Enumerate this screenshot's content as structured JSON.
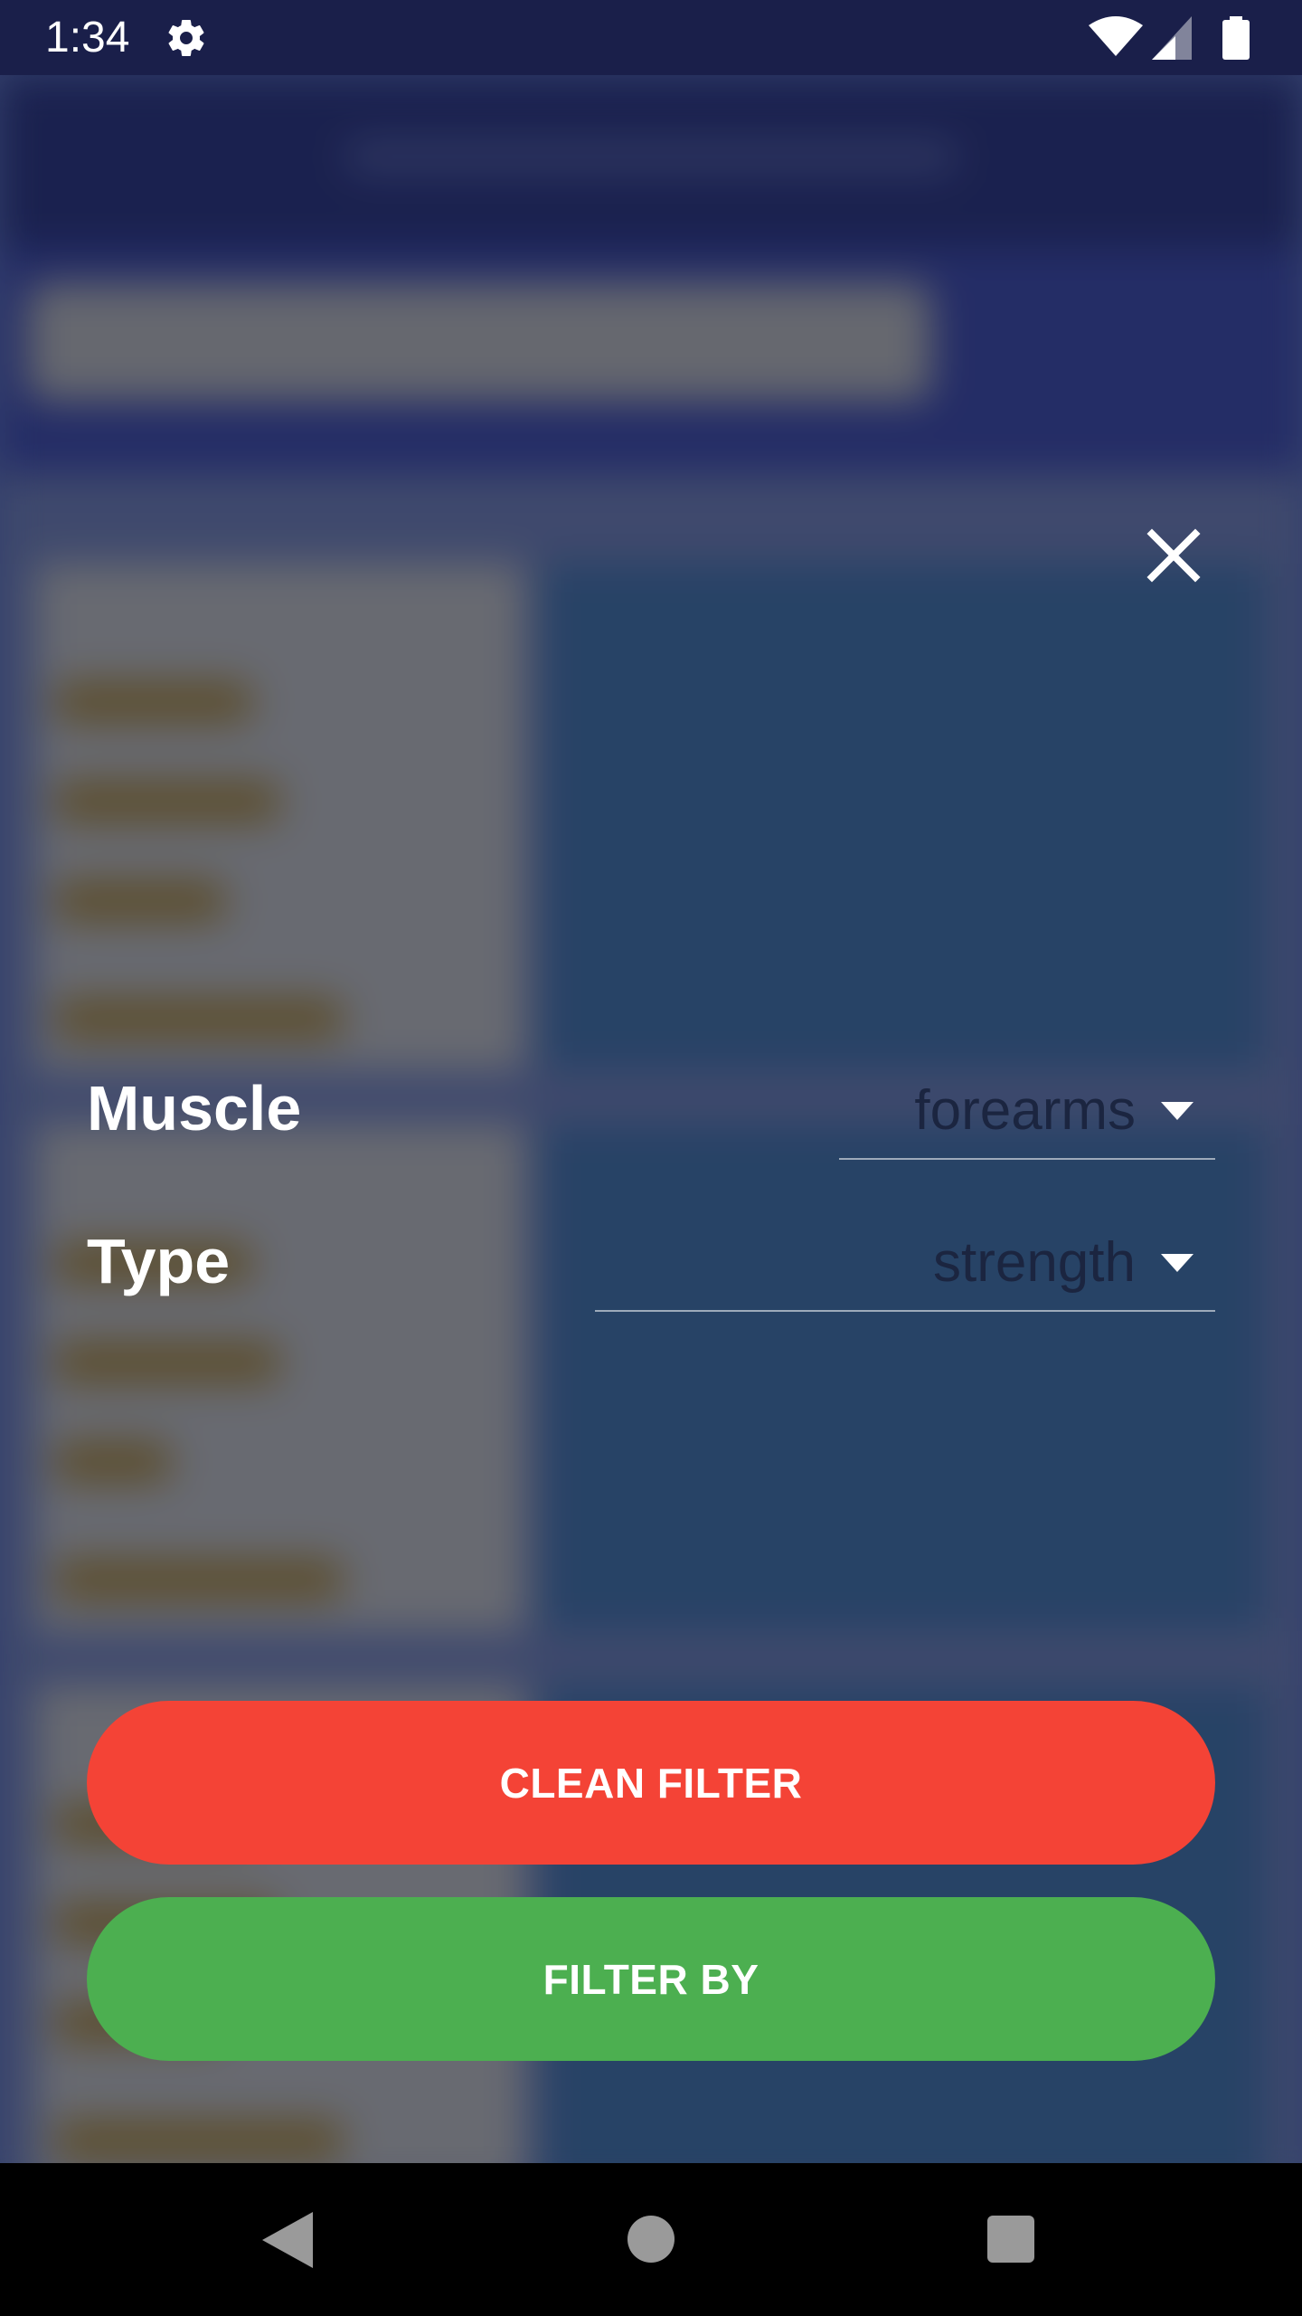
{
  "status_bar": {
    "time": "1:34",
    "icons": [
      "gear-icon",
      "wifi-icon",
      "cellular-signal-icon",
      "battery-icon"
    ]
  },
  "filter_dialog": {
    "close_icon": "close-icon",
    "muscle": {
      "label": "Muscle",
      "selected": "forearms"
    },
    "type": {
      "label": "Type",
      "selected": "strength"
    },
    "clean_button_label": "CLEAN FILTER",
    "filter_button_label": "FILTER BY"
  },
  "nav_bar": {
    "icons": [
      "back-icon",
      "home-icon",
      "recents-icon"
    ]
  },
  "colors": {
    "status_bar": "#1a1f4a",
    "clean_button": "#f44336",
    "filter_button": "#4caf50",
    "dropdown_text": "#1b2540",
    "nav_bar": "#000000"
  }
}
